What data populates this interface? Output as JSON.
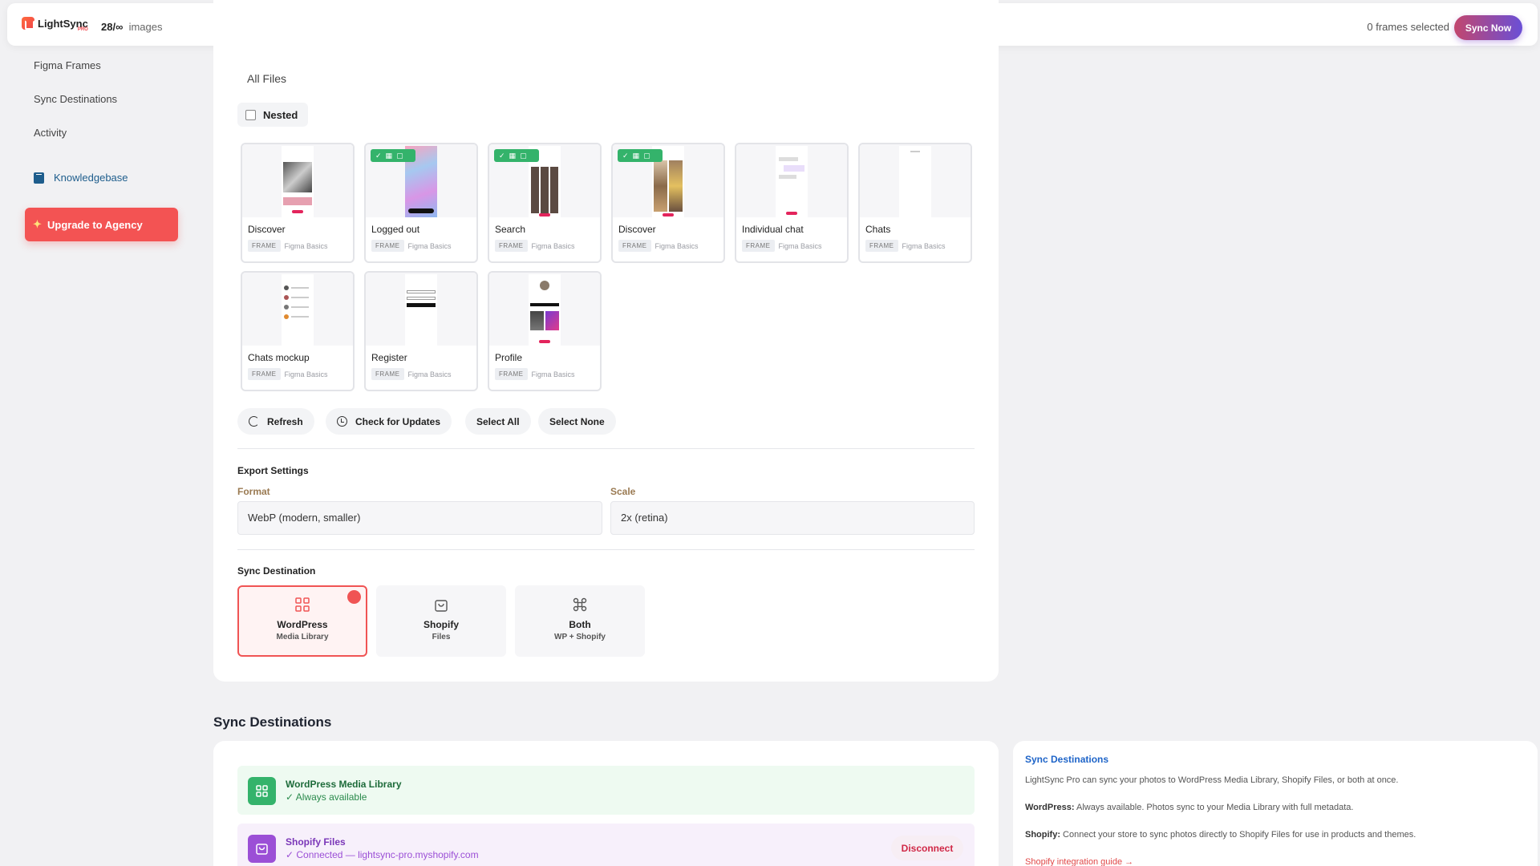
{
  "topbar": {
    "brand": "LightSync",
    "brand_tier": "PRO",
    "image_count": "28/∞",
    "image_count_suffix": "images",
    "frames_selected": "0 frames selected",
    "sync_now": "Sync Now"
  },
  "sidebar": {
    "items": [
      {
        "label": "Figma Frames"
      },
      {
        "label": "Sync Destinations"
      },
      {
        "label": "Activity"
      }
    ],
    "knowledgebase": "Knowledgebase",
    "upgrade": "Upgrade to Agency"
  },
  "files": {
    "heading": "All Files",
    "nested_label": "Nested",
    "frames": [
      {
        "name": "Discover",
        "type": "FRAME",
        "file": "Figma Basics",
        "selected": false
      },
      {
        "name": "Logged out",
        "type": "FRAME",
        "file": "Figma Basics",
        "selected": true
      },
      {
        "name": "Search",
        "type": "FRAME",
        "file": "Figma Basics",
        "selected": true
      },
      {
        "name": "Discover",
        "type": "FRAME",
        "file": "Figma Basics",
        "selected": true
      },
      {
        "name": "Individual chat",
        "type": "FRAME",
        "file": "Figma Basics",
        "selected": false
      },
      {
        "name": "Chats",
        "type": "FRAME",
        "file": "Figma Basics",
        "selected": false
      },
      {
        "name": "Chats mockup",
        "type": "FRAME",
        "file": "Figma Basics",
        "selected": false
      },
      {
        "name": "Register",
        "type": "FRAME",
        "file": "Figma Basics",
        "selected": false
      },
      {
        "name": "Profile",
        "type": "FRAME",
        "file": "Figma Basics",
        "selected": false
      }
    ],
    "actions": {
      "refresh": "Refresh",
      "check_updates": "Check for Updates",
      "select_all": "Select All",
      "select_none": "Select None"
    }
  },
  "export": {
    "heading": "Export Settings",
    "format_label": "Format",
    "format_value": "WebP (modern, smaller)",
    "scale_label": "Scale",
    "scale_value": "2x (retina)"
  },
  "sync_destination": {
    "heading": "Sync Destination",
    "options": [
      {
        "title": "WordPress",
        "sub": "Media Library",
        "active": true
      },
      {
        "title": "Shopify",
        "sub": "Files",
        "active": false
      },
      {
        "title": "Both",
        "sub": "WP + Shopify",
        "active": false
      }
    ]
  },
  "destinations_section": {
    "heading": "Sync Destinations",
    "wordpress": {
      "title": "WordPress Media Library",
      "status": "✓ Always available"
    },
    "shopify": {
      "title": "Shopify Files",
      "status": "✓ Connected — lightsync-pro.myshopify.com",
      "disconnect": "Disconnect"
    }
  },
  "help": {
    "title": "Sync Destinations",
    "intro": "LightSync Pro can sync your photos to WordPress Media Library, Shopify Files, or both at once.",
    "wp_label": "WordPress:",
    "wp_text": " Always available. Photos sync to your Media Library with full metadata.",
    "shopify_label": "Shopify:",
    "shopify_text": " Connect your store to sync photos directly to Shopify Files for use in products and themes.",
    "link": "Shopify integration guide →"
  },
  "colors": {
    "accent_red": "#f05454",
    "sync_gradient_start": "#c2466e",
    "sync_gradient_end": "#6a4fd6",
    "success_green": "#34b36b",
    "shopify_purple": "#9b4fd6"
  }
}
